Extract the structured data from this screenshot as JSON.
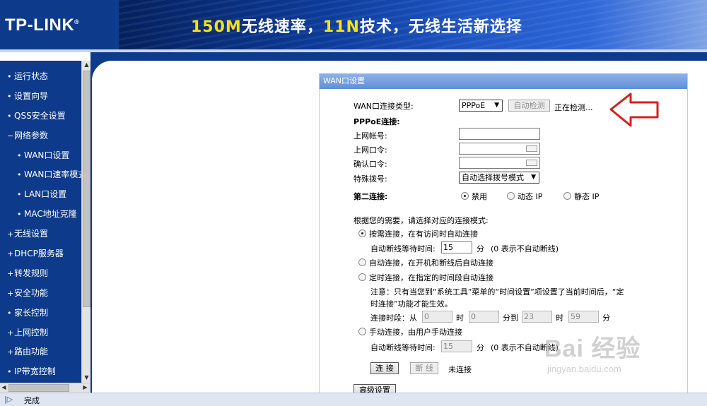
{
  "header": {
    "logo": "TP-LINK",
    "banner": {
      "part1": "150M",
      "part2": "无线速率，",
      "part3": "11N",
      "part4": "技术，无线生活新选择"
    }
  },
  "sidebar": {
    "items": [
      {
        "bullet": "•",
        "label": "运行状态"
      },
      {
        "bullet": "•",
        "label": "设置向导"
      },
      {
        "bullet": "•",
        "label": "QSS安全设置"
      },
      {
        "bullet": "−",
        "label": "网络参数"
      },
      {
        "bullet": "•",
        "label": "WAN口设置"
      },
      {
        "bullet": "•",
        "label": "WAN口速率模式"
      },
      {
        "bullet": "•",
        "label": "LAN口设置"
      },
      {
        "bullet": "•",
        "label": "MAC地址克隆"
      },
      {
        "bullet": "+",
        "label": "无线设置"
      },
      {
        "bullet": "+",
        "label": "DHCP服务器"
      },
      {
        "bullet": "+",
        "label": "转发规则"
      },
      {
        "bullet": "+",
        "label": "安全功能"
      },
      {
        "bullet": "•",
        "label": "家长控制"
      },
      {
        "bullet": "+",
        "label": "上网控制"
      },
      {
        "bullet": "+",
        "label": "路由功能"
      },
      {
        "bullet": "•",
        "label": "IP带宽控制"
      }
    ]
  },
  "panel": {
    "title": "WAN口设置",
    "wan_type_label": "WAN口连接类型:",
    "wan_type_value": "PPPoE",
    "auto_detect_button": "自动检测",
    "detecting_text": "正在检测...",
    "pppoe_heading": "PPPoE连接:",
    "account_label": "上网帐号:",
    "password_label": "上网口令:",
    "confirm_label": "确认口令:",
    "special_dial_label": "特殊拨号:",
    "special_dial_value": "自动选择拨号模式",
    "second_conn_label": "第二连接:",
    "second_options": [
      "禁用",
      "动态 IP",
      "静态 IP"
    ],
    "mode_prompt": "根据您的需要，请选择对应的连接模式:",
    "mode_on_demand": "按需连接，在有访问时自动连接",
    "idle_label": "自动断线等待时间:",
    "idle_value": "15",
    "idle_unit": "分",
    "idle_note": "(0 表示不自动断线)",
    "mode_auto": "自动连接，在开机和断线后自动连接",
    "mode_timed": "定时连接，在指定的时间段自动连接",
    "note_line1": "注意：只有当您到“系统工具”菜单的“时间设置”项设置了当前时间后，“定",
    "note_line2": "时连接”功能才能生效。",
    "period_label": "连接时段：从",
    "t1": "0",
    "hour1": "时",
    "t2": "0",
    "min_to": "分到",
    "t3": "23",
    "hour2": "时",
    "t4": "59",
    "min_end": "分",
    "mode_manual": "手动连接，由用户手动连接",
    "idle_value2": "15",
    "connect_button": "连 接",
    "disconnect_button": "断 线",
    "status_text": "未连接",
    "advanced_button": "高级设置"
  },
  "statusbar": {
    "text": "完成"
  },
  "watermark": {
    "main": "Bai 经验",
    "sub": "jingyan.baidu.com"
  }
}
